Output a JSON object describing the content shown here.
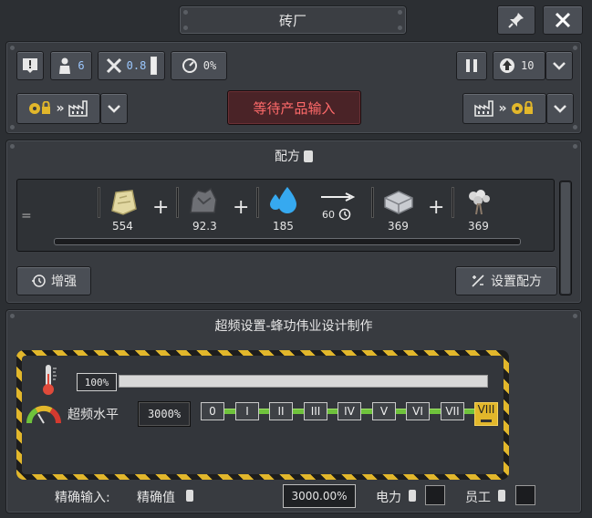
{
  "window": {
    "title": "砖厂",
    "pin_icon": "pin-icon",
    "close_icon": "close-icon"
  },
  "toolbar": {
    "workers_count": "6",
    "efficiency": "0.8",
    "speed_percent": "0%",
    "priority_value": "10",
    "status_text": "等待产品输入"
  },
  "recipe": {
    "header": "配方",
    "inputs": [
      {
        "name": "clay-resource-icon",
        "value": "554"
      },
      {
        "name": "stone-resource-icon",
        "value": "92.3"
      },
      {
        "name": "water-resource-icon",
        "value": "185"
      }
    ],
    "time": "60",
    "outputs": [
      {
        "name": "brick-resource-icon",
        "value": "369"
      },
      {
        "name": "dust-resource-icon",
        "value": "369"
      }
    ],
    "boost_label": "增强",
    "set_recipe_label": "设置配方"
  },
  "overclock": {
    "header": "超频设置-蜂功伟业设计制作",
    "bar_value": "100%",
    "bar_fill_percent": 100,
    "level_label": "超频水平",
    "level_value": "3000%",
    "levels": [
      "0",
      "I",
      "II",
      "III",
      "IV",
      "V",
      "VI",
      "VII",
      "VIII"
    ],
    "selected_level": "VIII"
  },
  "footer": {
    "precise_input_label": "精确输入:",
    "precise_value_label": "精确值",
    "precise_value": "3000.00%",
    "power_label": "电力",
    "worker_label": "员工"
  },
  "colors": {
    "status_red": "#ff5a5a",
    "accent_yellow": "#e2b72b",
    "water_blue": "#36a9f0",
    "green_track": "#6fc23c"
  }
}
